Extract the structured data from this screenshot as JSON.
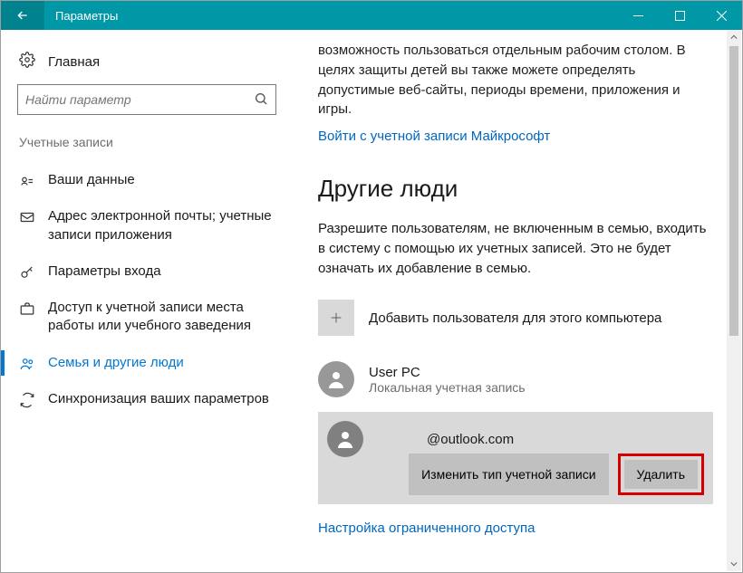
{
  "titlebar": {
    "title": "Параметры"
  },
  "sidebar": {
    "home": "Главная",
    "search_placeholder": "Найти параметр",
    "category": "Учетные записи",
    "items": [
      {
        "label": "Ваши данные"
      },
      {
        "label": "Адрес электронной почты; учетные записи приложения"
      },
      {
        "label": "Параметры входа"
      },
      {
        "label": "Доступ к учетной записи места работы или учебного заведения"
      },
      {
        "label": "Семья и другие люди"
      },
      {
        "label": "Синхронизация ваших параметров"
      }
    ]
  },
  "content": {
    "intro_para": "возможность пользоваться отдельным рабочим столом. В целях защиты детей вы также можете определять допустимые веб-сайты, периоды времени, приложения и игры.",
    "signin_link": "Войти с учетной записи Майкрософт",
    "section_title": "Другие люди",
    "section_para": "Разрешите пользователям, не включенным в семью, входить в систему с помощью их учетных записей. Это не будет означать их добавление в семью.",
    "add_user": "Добавить пользователя для этого компьютера",
    "user1": {
      "name": "User PC",
      "type": "Локальная учетная запись"
    },
    "user2": {
      "name": "@outlook.com"
    },
    "change_type_btn": "Изменить тип учетной записи",
    "delete_btn": "Удалить",
    "restricted_link": "Настройка ограниченного доступа"
  }
}
